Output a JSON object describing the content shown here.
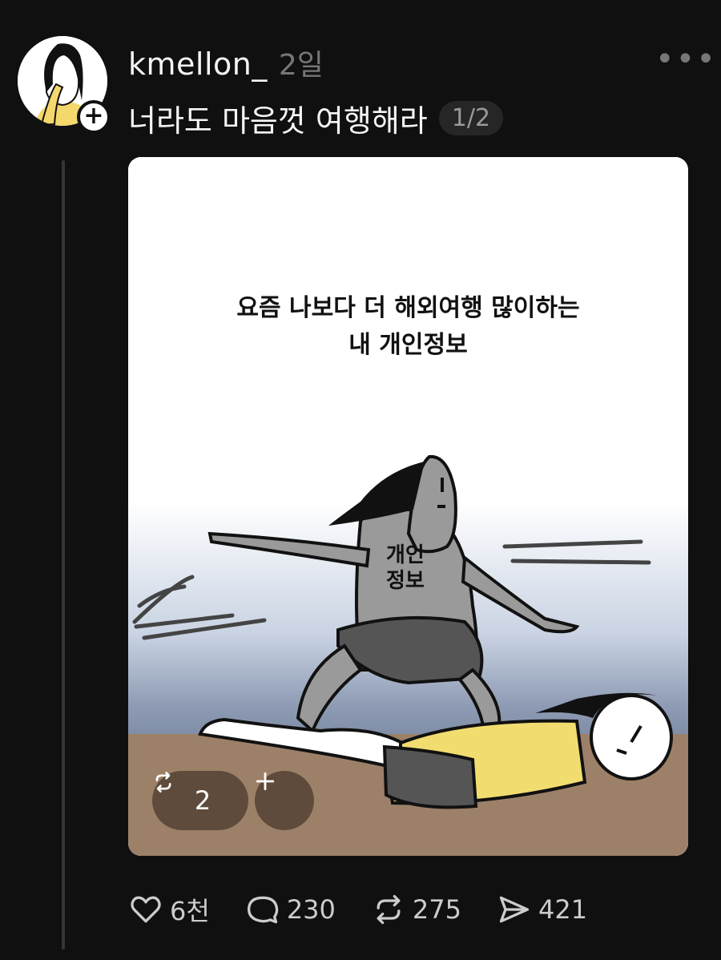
{
  "post": {
    "username": "kmellon_",
    "time": "2일",
    "text": "너라도 마음껏 여행해라",
    "page_indicator": "1/2"
  },
  "media": {
    "caption_line1": "요즘 나보다 더 해외여행 많이하는",
    "caption_line2": "내 개인정보",
    "shirt_line1": "개인",
    "shirt_line2": "정보",
    "repost_chip_count": "2"
  },
  "actions": {
    "like_count": "6천",
    "comment_count": "230",
    "repost_count": "275",
    "share_count": "421"
  },
  "icons": {
    "more": "more-horizontal-icon",
    "follow": "plus-icon",
    "like": "heart-icon",
    "comment": "comment-icon",
    "repost": "repost-icon",
    "share": "send-icon"
  }
}
